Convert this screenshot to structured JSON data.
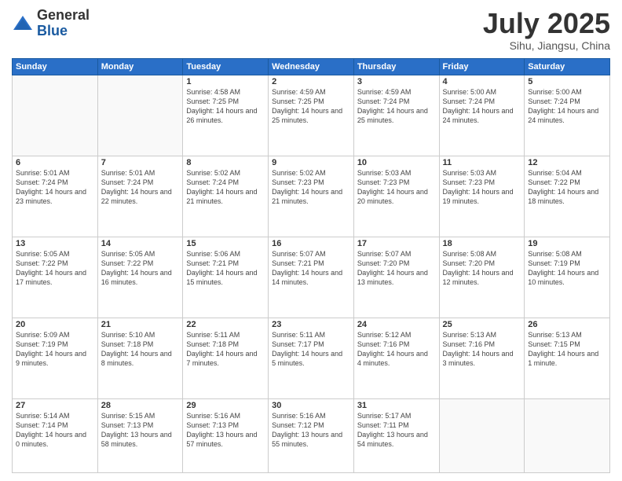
{
  "logo": {
    "general": "General",
    "blue": "Blue"
  },
  "header": {
    "month": "July 2025",
    "location": "Sihu, Jiangsu, China"
  },
  "days_of_week": [
    "Sunday",
    "Monday",
    "Tuesday",
    "Wednesday",
    "Thursday",
    "Friday",
    "Saturday"
  ],
  "weeks": [
    [
      {
        "day": "",
        "sunrise": "",
        "sunset": "",
        "daylight": ""
      },
      {
        "day": "",
        "sunrise": "",
        "sunset": "",
        "daylight": ""
      },
      {
        "day": "1",
        "sunrise": "Sunrise: 4:58 AM",
        "sunset": "Sunset: 7:25 PM",
        "daylight": "Daylight: 14 hours and 26 minutes."
      },
      {
        "day": "2",
        "sunrise": "Sunrise: 4:59 AM",
        "sunset": "Sunset: 7:25 PM",
        "daylight": "Daylight: 14 hours and 25 minutes."
      },
      {
        "day": "3",
        "sunrise": "Sunrise: 4:59 AM",
        "sunset": "Sunset: 7:24 PM",
        "daylight": "Daylight: 14 hours and 25 minutes."
      },
      {
        "day": "4",
        "sunrise": "Sunrise: 5:00 AM",
        "sunset": "Sunset: 7:24 PM",
        "daylight": "Daylight: 14 hours and 24 minutes."
      },
      {
        "day": "5",
        "sunrise": "Sunrise: 5:00 AM",
        "sunset": "Sunset: 7:24 PM",
        "daylight": "Daylight: 14 hours and 24 minutes."
      }
    ],
    [
      {
        "day": "6",
        "sunrise": "Sunrise: 5:01 AM",
        "sunset": "Sunset: 7:24 PM",
        "daylight": "Daylight: 14 hours and 23 minutes."
      },
      {
        "day": "7",
        "sunrise": "Sunrise: 5:01 AM",
        "sunset": "Sunset: 7:24 PM",
        "daylight": "Daylight: 14 hours and 22 minutes."
      },
      {
        "day": "8",
        "sunrise": "Sunrise: 5:02 AM",
        "sunset": "Sunset: 7:24 PM",
        "daylight": "Daylight: 14 hours and 21 minutes."
      },
      {
        "day": "9",
        "sunrise": "Sunrise: 5:02 AM",
        "sunset": "Sunset: 7:23 PM",
        "daylight": "Daylight: 14 hours and 21 minutes."
      },
      {
        "day": "10",
        "sunrise": "Sunrise: 5:03 AM",
        "sunset": "Sunset: 7:23 PM",
        "daylight": "Daylight: 14 hours and 20 minutes."
      },
      {
        "day": "11",
        "sunrise": "Sunrise: 5:03 AM",
        "sunset": "Sunset: 7:23 PM",
        "daylight": "Daylight: 14 hours and 19 minutes."
      },
      {
        "day": "12",
        "sunrise": "Sunrise: 5:04 AM",
        "sunset": "Sunset: 7:22 PM",
        "daylight": "Daylight: 14 hours and 18 minutes."
      }
    ],
    [
      {
        "day": "13",
        "sunrise": "Sunrise: 5:05 AM",
        "sunset": "Sunset: 7:22 PM",
        "daylight": "Daylight: 14 hours and 17 minutes."
      },
      {
        "day": "14",
        "sunrise": "Sunrise: 5:05 AM",
        "sunset": "Sunset: 7:22 PM",
        "daylight": "Daylight: 14 hours and 16 minutes."
      },
      {
        "day": "15",
        "sunrise": "Sunrise: 5:06 AM",
        "sunset": "Sunset: 7:21 PM",
        "daylight": "Daylight: 14 hours and 15 minutes."
      },
      {
        "day": "16",
        "sunrise": "Sunrise: 5:07 AM",
        "sunset": "Sunset: 7:21 PM",
        "daylight": "Daylight: 14 hours and 14 minutes."
      },
      {
        "day": "17",
        "sunrise": "Sunrise: 5:07 AM",
        "sunset": "Sunset: 7:20 PM",
        "daylight": "Daylight: 14 hours and 13 minutes."
      },
      {
        "day": "18",
        "sunrise": "Sunrise: 5:08 AM",
        "sunset": "Sunset: 7:20 PM",
        "daylight": "Daylight: 14 hours and 12 minutes."
      },
      {
        "day": "19",
        "sunrise": "Sunrise: 5:08 AM",
        "sunset": "Sunset: 7:19 PM",
        "daylight": "Daylight: 14 hours and 10 minutes."
      }
    ],
    [
      {
        "day": "20",
        "sunrise": "Sunrise: 5:09 AM",
        "sunset": "Sunset: 7:19 PM",
        "daylight": "Daylight: 14 hours and 9 minutes."
      },
      {
        "day": "21",
        "sunrise": "Sunrise: 5:10 AM",
        "sunset": "Sunset: 7:18 PM",
        "daylight": "Daylight: 14 hours and 8 minutes."
      },
      {
        "day": "22",
        "sunrise": "Sunrise: 5:11 AM",
        "sunset": "Sunset: 7:18 PM",
        "daylight": "Daylight: 14 hours and 7 minutes."
      },
      {
        "day": "23",
        "sunrise": "Sunrise: 5:11 AM",
        "sunset": "Sunset: 7:17 PM",
        "daylight": "Daylight: 14 hours and 5 minutes."
      },
      {
        "day": "24",
        "sunrise": "Sunrise: 5:12 AM",
        "sunset": "Sunset: 7:16 PM",
        "daylight": "Daylight: 14 hours and 4 minutes."
      },
      {
        "day": "25",
        "sunrise": "Sunrise: 5:13 AM",
        "sunset": "Sunset: 7:16 PM",
        "daylight": "Daylight: 14 hours and 3 minutes."
      },
      {
        "day": "26",
        "sunrise": "Sunrise: 5:13 AM",
        "sunset": "Sunset: 7:15 PM",
        "daylight": "Daylight: 14 hours and 1 minute."
      }
    ],
    [
      {
        "day": "27",
        "sunrise": "Sunrise: 5:14 AM",
        "sunset": "Sunset: 7:14 PM",
        "daylight": "Daylight: 14 hours and 0 minutes."
      },
      {
        "day": "28",
        "sunrise": "Sunrise: 5:15 AM",
        "sunset": "Sunset: 7:13 PM",
        "daylight": "Daylight: 13 hours and 58 minutes."
      },
      {
        "day": "29",
        "sunrise": "Sunrise: 5:16 AM",
        "sunset": "Sunset: 7:13 PM",
        "daylight": "Daylight: 13 hours and 57 minutes."
      },
      {
        "day": "30",
        "sunrise": "Sunrise: 5:16 AM",
        "sunset": "Sunset: 7:12 PM",
        "daylight": "Daylight: 13 hours and 55 minutes."
      },
      {
        "day": "31",
        "sunrise": "Sunrise: 5:17 AM",
        "sunset": "Sunset: 7:11 PM",
        "daylight": "Daylight: 13 hours and 54 minutes."
      },
      {
        "day": "",
        "sunrise": "",
        "sunset": "",
        "daylight": ""
      },
      {
        "day": "",
        "sunrise": "",
        "sunset": "",
        "daylight": ""
      }
    ]
  ]
}
